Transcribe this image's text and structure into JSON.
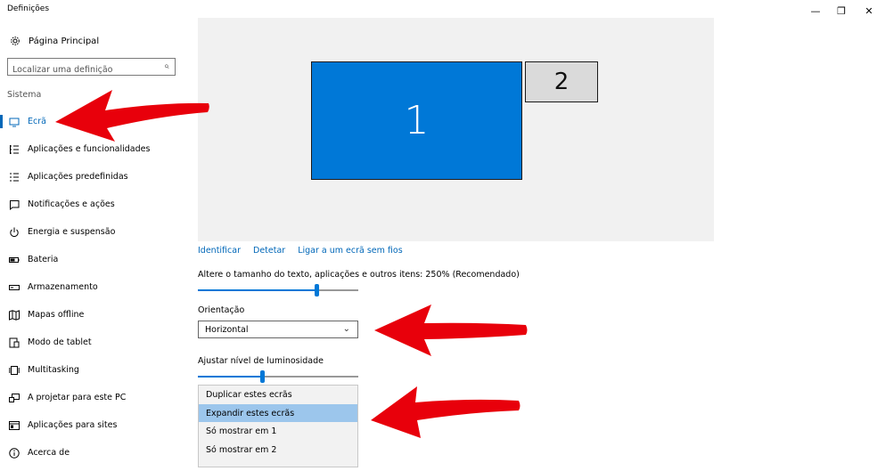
{
  "window": {
    "title": "Definições",
    "minimize_glyph": "—",
    "restore_glyph": "❐",
    "close_glyph": "✕"
  },
  "sidebar": {
    "home": {
      "icon": "gear-icon",
      "label": "Página Principal"
    },
    "search": {
      "placeholder": "Localizar uma definição",
      "icon": "search-icon"
    },
    "section_title": "Sistema",
    "items": [
      {
        "label": "Ecrã",
        "icon": "monitor-icon",
        "active": true
      },
      {
        "label": "Aplicações e funcionalidades",
        "icon": "apps-list-icon"
      },
      {
        "label": "Aplicações predefinidas",
        "icon": "default-apps-icon"
      },
      {
        "label": "Notificações e ações",
        "icon": "notification-icon"
      },
      {
        "label": "Energia e suspensão",
        "icon": "power-icon"
      },
      {
        "label": "Bateria",
        "icon": "battery-icon"
      },
      {
        "label": "Armazenamento",
        "icon": "storage-icon"
      },
      {
        "label": "Mapas offline",
        "icon": "map-icon"
      },
      {
        "label": "Modo de tablet",
        "icon": "tablet-icon"
      },
      {
        "label": "Multitasking",
        "icon": "multitasking-icon"
      },
      {
        "label": "A projetar para este PC",
        "icon": "project-icon"
      },
      {
        "label": "Aplicações para sites",
        "icon": "apps-for-sites-icon"
      },
      {
        "label": "Acerca de",
        "icon": "info-icon"
      }
    ]
  },
  "display": {
    "monitor_1_label": "1",
    "monitor_2_label": "2",
    "links": {
      "identify": "Identificar",
      "detect": "Detetar",
      "wireless": "Ligar a um ecrã sem fios"
    },
    "scale_label": "Altere o tamanho do texto, aplicações e outros itens: 250% (Recomendado)",
    "scale_slider_fraction": 0.74,
    "orientation_label": "Orientação",
    "orientation_value": "Horizontal",
    "brightness_label": "Ajustar nível de luminosidade",
    "brightness_slider_fraction": 0.4,
    "multiple_displays_options": [
      {
        "label": "Duplicar estes ecrãs",
        "selected": false
      },
      {
        "label": "Expandir estes ecrãs",
        "selected": true
      },
      {
        "label": "Só mostrar em 1",
        "selected": false
      },
      {
        "label": "Só mostrar em 2",
        "selected": false
      }
    ]
  },
  "colors": {
    "accent": "#0078d7",
    "link": "#0067b8",
    "selected_option": "#9cc6ec",
    "annotation_arrow": "#e8000b"
  }
}
